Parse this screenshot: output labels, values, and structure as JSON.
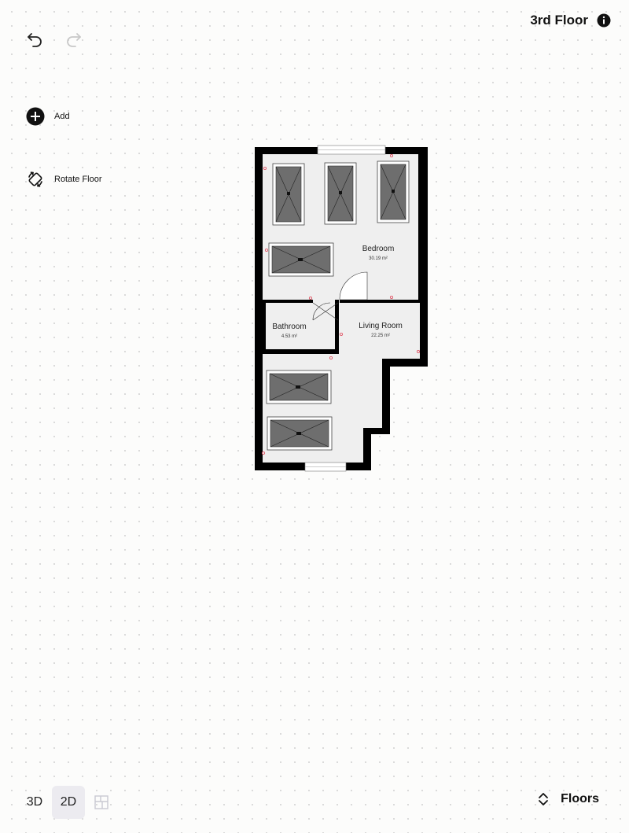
{
  "header": {
    "floor_name": "3rd Floor"
  },
  "toolbar": {
    "undo_icon": "undo-icon",
    "redo_icon": "redo-icon",
    "redo_enabled": false
  },
  "sidebar": {
    "add_label": "Add",
    "rotate_label": "Rotate Floor"
  },
  "floorplan": {
    "rooms": [
      {
        "name": "Bedroom",
        "area": "30.19 m²"
      },
      {
        "name": "Bathroom",
        "area": "4.53 m²"
      },
      {
        "name": "Living Room",
        "area": "22.25 m²"
      }
    ]
  },
  "view_modes": {
    "mode_3d": "3D",
    "mode_2d": "2D",
    "mode_floorplan_icon": "floorplan-icon",
    "selected": "2D"
  },
  "floors_button": {
    "label": "Floors"
  },
  "colors": {
    "wall": "#000000",
    "floor": "#efefef",
    "furniture": "#6e6e6e",
    "accent_marker": "#e05a6a",
    "selected_mode_bg": "#ecebf0"
  }
}
